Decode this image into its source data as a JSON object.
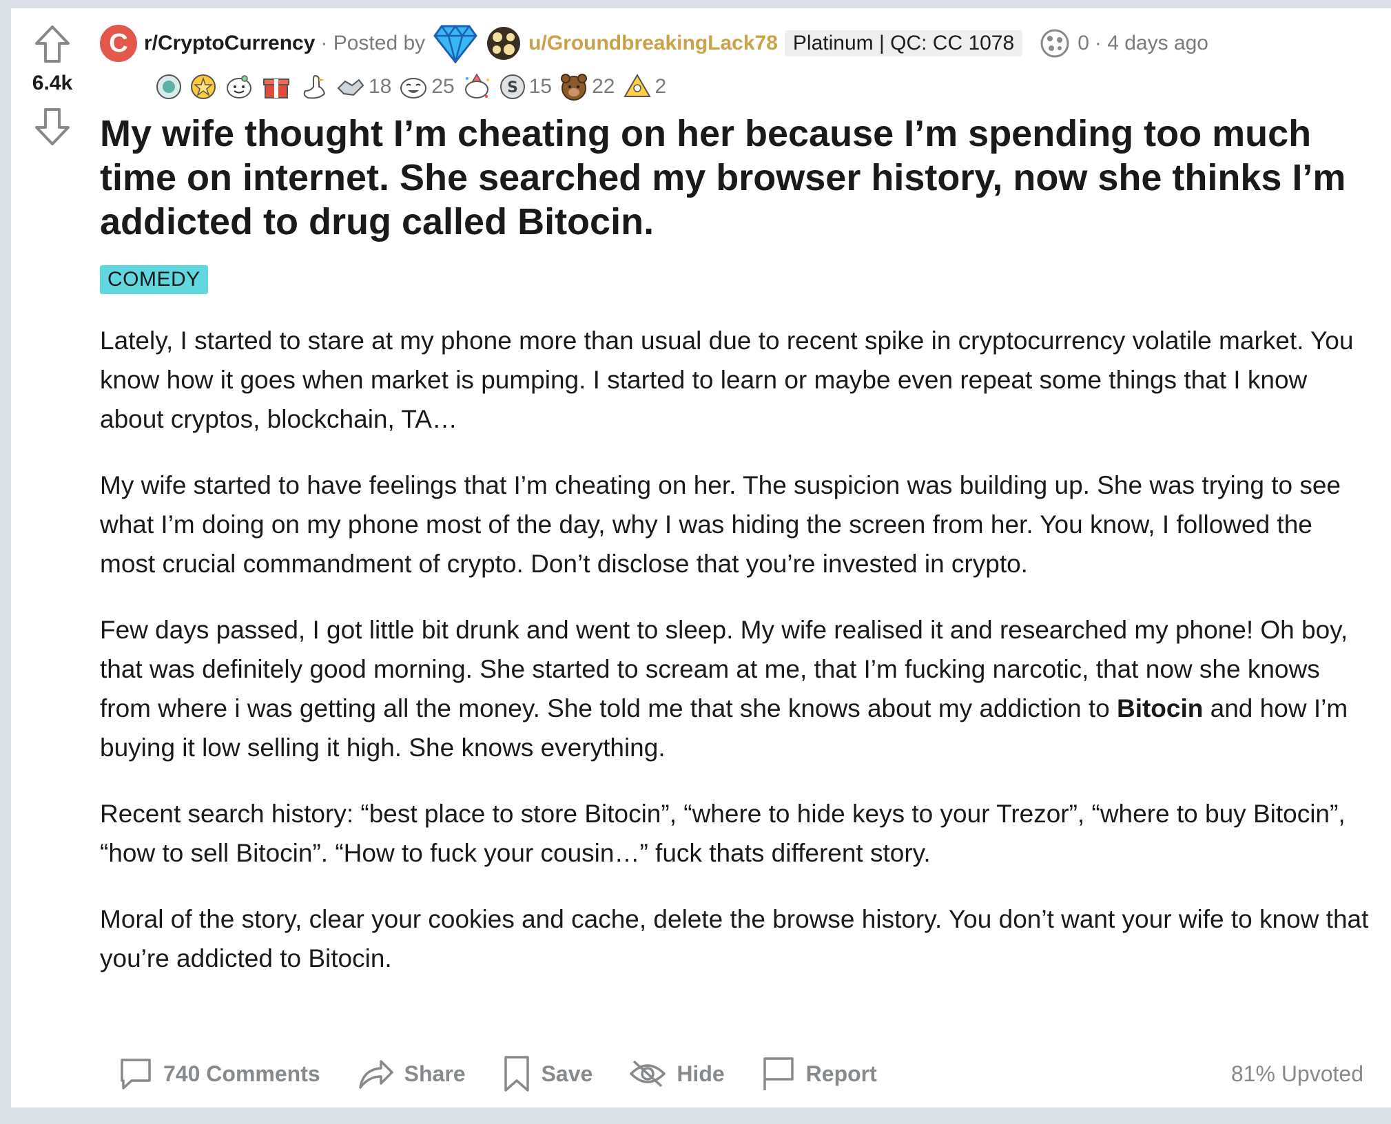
{
  "vote": {
    "count": "6.4k"
  },
  "meta": {
    "subreddit": "r/CryptoCurrency",
    "subreddit_icon_letter": "C",
    "posted_by": "· Posted by",
    "username": "u/GroundbreakingLack78",
    "flair": "Platinum | QC: CC 1078",
    "karma": "0",
    "time": "· 4 days ago",
    "username_color": "#c9a24a"
  },
  "awards": [
    {
      "icon": "helpful-award-icon",
      "count": ""
    },
    {
      "icon": "star-award-icon",
      "count": ""
    },
    {
      "icon": "wholesome-award-icon",
      "count": ""
    },
    {
      "icon": "gift-award-icon",
      "count": ""
    },
    {
      "icon": "goose-award-icon",
      "count": ""
    },
    {
      "icon": "handshake-award-icon",
      "count": "18"
    },
    {
      "icon": "laughing-award-icon",
      "count": "25"
    },
    {
      "icon": "party-award-icon",
      "count": ""
    },
    {
      "icon": "silver-jar-award-icon",
      "count": "15"
    },
    {
      "icon": "bear-award-icon",
      "count": "22"
    },
    {
      "icon": "rocket-award-icon",
      "count": "2"
    }
  ],
  "post": {
    "title": "My wife thought I’m cheating on her because I’m spending too much time on internet. She searched my browser history, now she thinks I’m addicted to drug called Bitocin.",
    "tag": "COMEDY",
    "tag_color": "#61d8e0",
    "paragraphs": {
      "p1": "Lately, I started to stare at my phone more than usual due to recent spike in cryptocurrency volatile market. You know how it goes when market is pumping. I started to learn or maybe even repeat some things that I know about cryptos, blockchain, TA…",
      "p2": "My wife started to have feelings that I’m cheating on her. The suspicion was building up. She was trying to see what I’m doing on my phone most of the day, why I was hiding the screen from her. You know, I followed the most crucial commandment of crypto. Don’t disclose that you’re invested in crypto.",
      "p3_before": "Few days passed, I got little bit drunk and went to sleep. My wife realised it and researched my phone! Oh boy, that was definitely good morning. She started to scream at me, that I’m fucking narcotic, that now she knows from where i was getting all the money. She told me that she knows about my addiction to ",
      "p3_bold": "Bitocin",
      "p3_after": " and how I’m buying it low selling it high. She knows everything.",
      "p4": "Recent search history: “best place to store Bitocin”, “where to hide keys to your Trezor”, “where to buy Bitocin”, “how to sell Bitocin”. “How to fuck your cousin…” fuck thats different story.",
      "p5": "Moral of the story, clear your cookies and cache, delete the browse history. You don’t want your wife to know that you’re addicted to Bitocin."
    }
  },
  "actions": {
    "comments": "740 Comments",
    "share": "Share",
    "save": "Save",
    "hide": "Hide",
    "report": "Report",
    "upvoted": "81% Upvoted"
  }
}
